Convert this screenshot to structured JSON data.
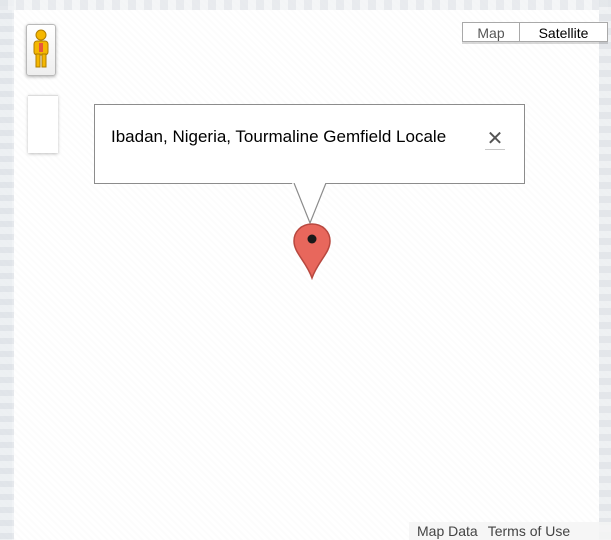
{
  "map_type": {
    "map_label": "Map",
    "satellite_label": "Satellite",
    "selected": "Satellite"
  },
  "info_window": {
    "text": "Ibadan, Nigeria, Tourmaline Gemfield Locale",
    "close_icon": "close-icon"
  },
  "marker": {
    "icon": "map-marker-icon",
    "color": "#e8675c"
  },
  "pegman": {
    "icon": "pegman-icon",
    "color": "#f5b700"
  },
  "footer": {
    "map_data": "Map Data",
    "terms": "Terms of Use"
  }
}
